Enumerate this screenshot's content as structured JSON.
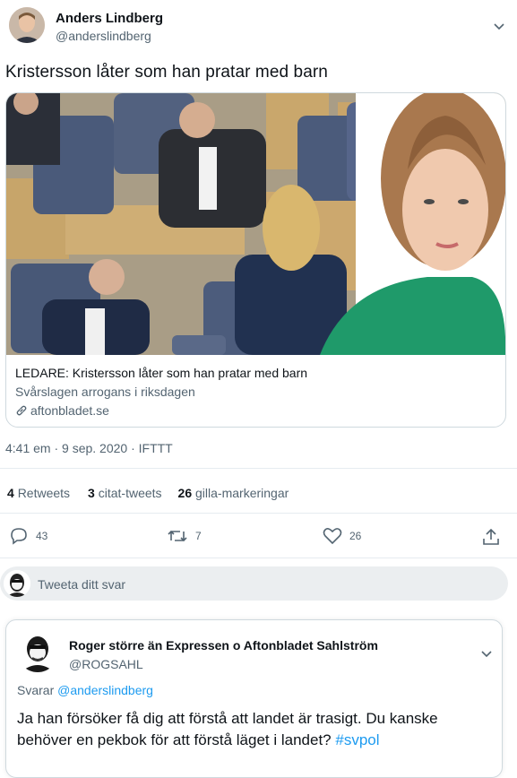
{
  "tweet": {
    "author_name": "Anders Lindberg",
    "author_handle": "@anderslindberg",
    "text": "Kristersson låter som han pratar med barn",
    "card": {
      "title": "LEDARE: Kristersson låter som han pratar med barn",
      "description": "Svårslagen arrogans i riksdagen",
      "domain": "aftonbladet.se"
    },
    "meta": "4:41 em · 9 sep. 2020 · IFTTT",
    "stats": {
      "retweets_count": "4",
      "retweets_label": "Retweets",
      "quotes_count": "3",
      "quotes_label": "citat-tweets",
      "likes_count": "26",
      "likes_label": "gilla-markeringar"
    },
    "actions": {
      "replies": "43",
      "retweets": "7",
      "likes": "26"
    }
  },
  "reply_box": {
    "placeholder": "Tweeta ditt svar"
  },
  "reply": {
    "author_name": "Roger större än Expressen o Aftonbladet Sahlström",
    "author_handle": "@ROGSAHL",
    "replying_prefix": "Svarar",
    "replying_to": "@anderslindberg",
    "text": "Ja han försöker få dig att förstå att landet är trasigt. Du kanske behöver en pekbok för att förstå läget i landet?",
    "hashtag": "#svpol"
  },
  "colors": {
    "accent": "#1d9bf0",
    "secondary_text": "#536471",
    "border": "#cfd9de"
  },
  "icons": [
    "chevron-down-icon",
    "link-icon",
    "reply-icon",
    "retweet-icon",
    "like-icon",
    "share-icon"
  ]
}
